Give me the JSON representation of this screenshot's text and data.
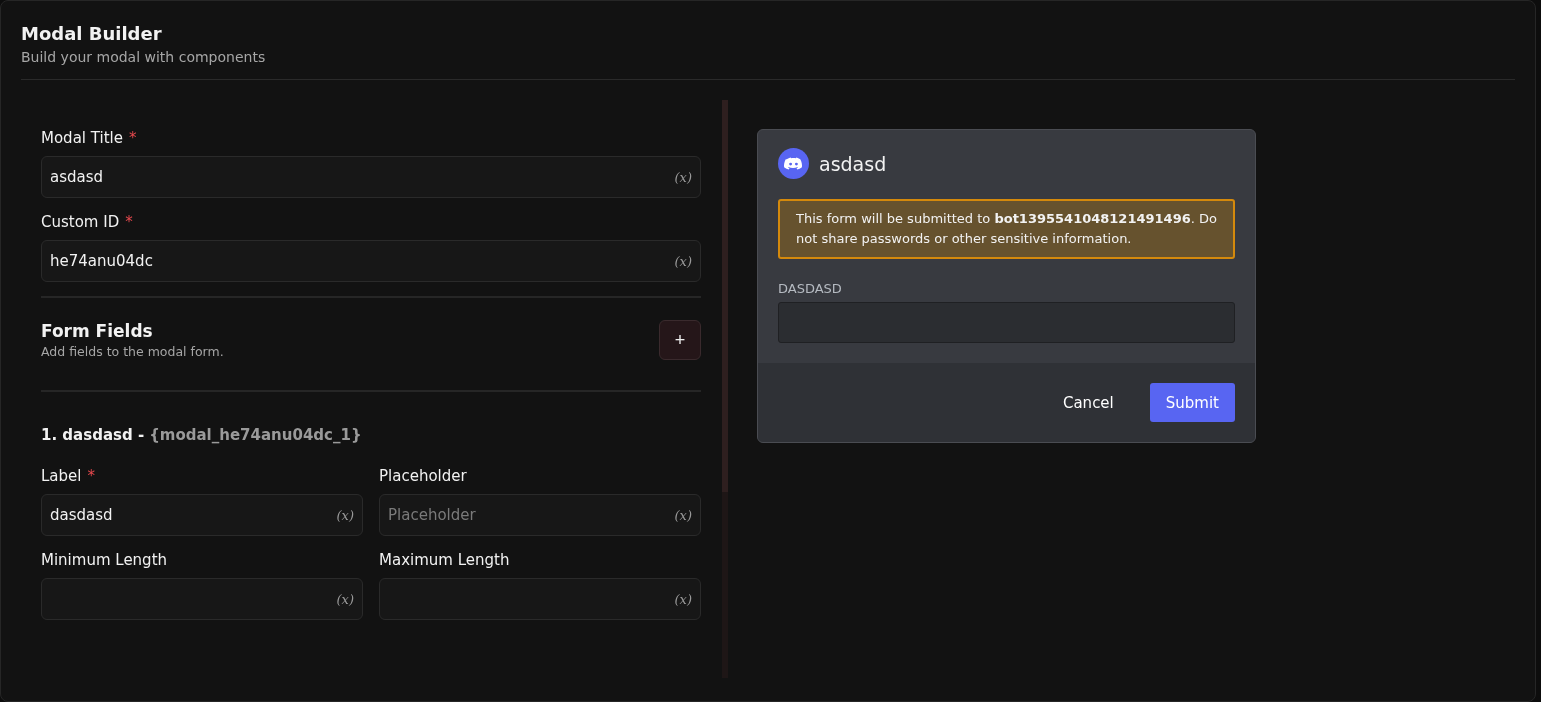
{
  "header": {
    "title": "Modal Builder",
    "subtitle": "Build your modal with components"
  },
  "settings": [
    {
      "label": "Modal Title",
      "required_mark": "*",
      "value": "asdasd",
      "icon": "(x)"
    },
    {
      "label": "Custom ID",
      "required_mark": "*",
      "value": "he74anu04dc",
      "icon": "(x)"
    }
  ],
  "form_fields": {
    "title": "Form Fields",
    "description": "Add fields to the modal form.",
    "add_button": "+",
    "items": [
      {
        "heading": "1. dasdasd -",
        "variable": "{modal_he74anu04dc_1}",
        "inputs": [
          {
            "label": "Label",
            "required_mark": "*",
            "value": "dasdasd",
            "icon": "(x)"
          },
          {
            "label": "Placeholder",
            "placeholder": "Placeholder",
            "icon": "(x)"
          },
          {
            "label": "Minimum Length",
            "icon": "(x)"
          },
          {
            "label": "Maximum Length",
            "icon": "(x)"
          }
        ]
      }
    ]
  },
  "preview": {
    "title": "asdasd",
    "notice": "This form will be submitted to **bot1395541048121491496**. Do not share passwords or other sensitive information.",
    "field_label": "DASDASD",
    "buttons": [
      {
        "label": "Cancel",
        "kind": "link"
      },
      {
        "label": "Submit",
        "kind": "primary"
      }
    ]
  }
}
